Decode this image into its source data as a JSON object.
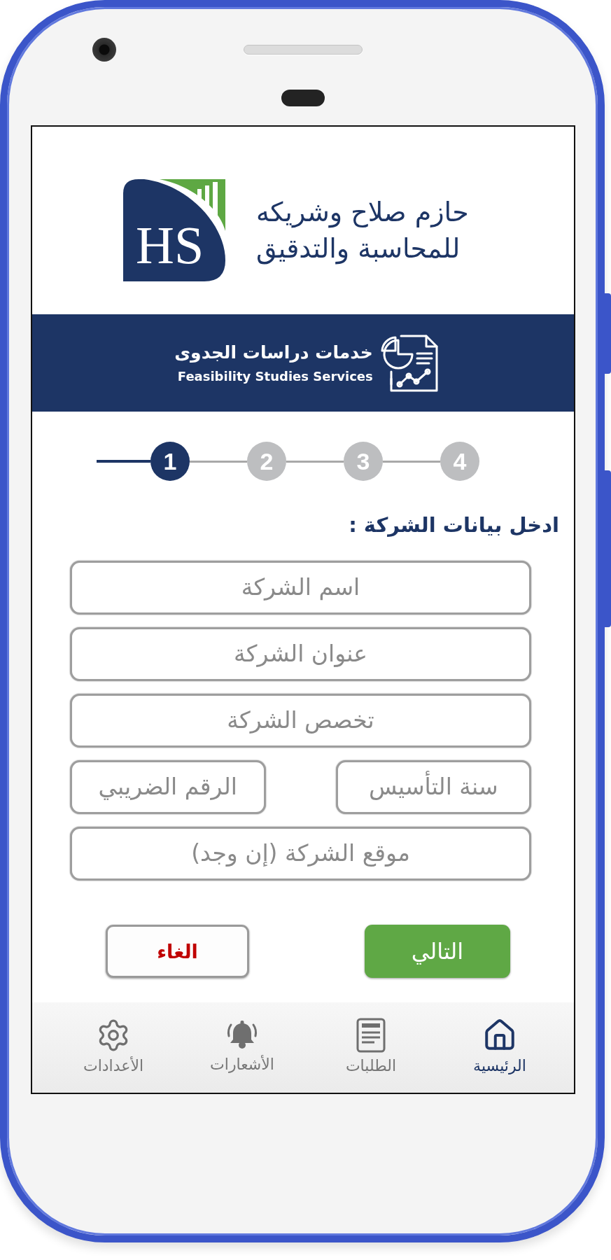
{
  "header": {
    "logo_text": "HS",
    "company_name": [
      "حازم صلاح وشريكه",
      "للمحاسبة والتدقيق"
    ]
  },
  "banner": {
    "title": "خدمات دراسات الجدوى",
    "subtitle": "Feasibility Studies Services"
  },
  "stepper": {
    "steps": [
      {
        "label": "4",
        "selected": false
      },
      {
        "label": "3",
        "selected": false
      },
      {
        "label": "2",
        "selected": false
      },
      {
        "label": "1",
        "selected": true
      }
    ]
  },
  "form": {
    "heading": "ادخل بيانات الشركة :",
    "rows": [
      {
        "fields": [
          {
            "placeholder": "اسم الشركة"
          }
        ]
      },
      {
        "fields": [
          {
            "placeholder": "عنوان الشركة"
          }
        ]
      },
      {
        "fields": [
          {
            "placeholder": "تخصص الشركة"
          }
        ]
      },
      {
        "fields": [
          {
            "placeholder": "سنة التأسيس"
          },
          {
            "placeholder": "الرقم الضريبي"
          }
        ]
      },
      {
        "fields": [
          {
            "placeholder": "موقع الشركة (إن وجد)"
          }
        ]
      }
    ]
  },
  "buttons": [
    {
      "label": "التالي",
      "kind": "next"
    },
    {
      "label": "الغاء",
      "kind": "cancel"
    }
  ],
  "bottom_nav": {
    "items": [
      {
        "label": "الرئيسية",
        "kind": "home",
        "selected": true
      },
      {
        "label": "الطلبات",
        "kind": "orders",
        "selected": false
      },
      {
        "label": "الأشعارات",
        "kind": "notifications",
        "selected": false
      },
      {
        "label": "الأعدادات",
        "kind": "settings",
        "selected": false
      }
    ]
  }
}
